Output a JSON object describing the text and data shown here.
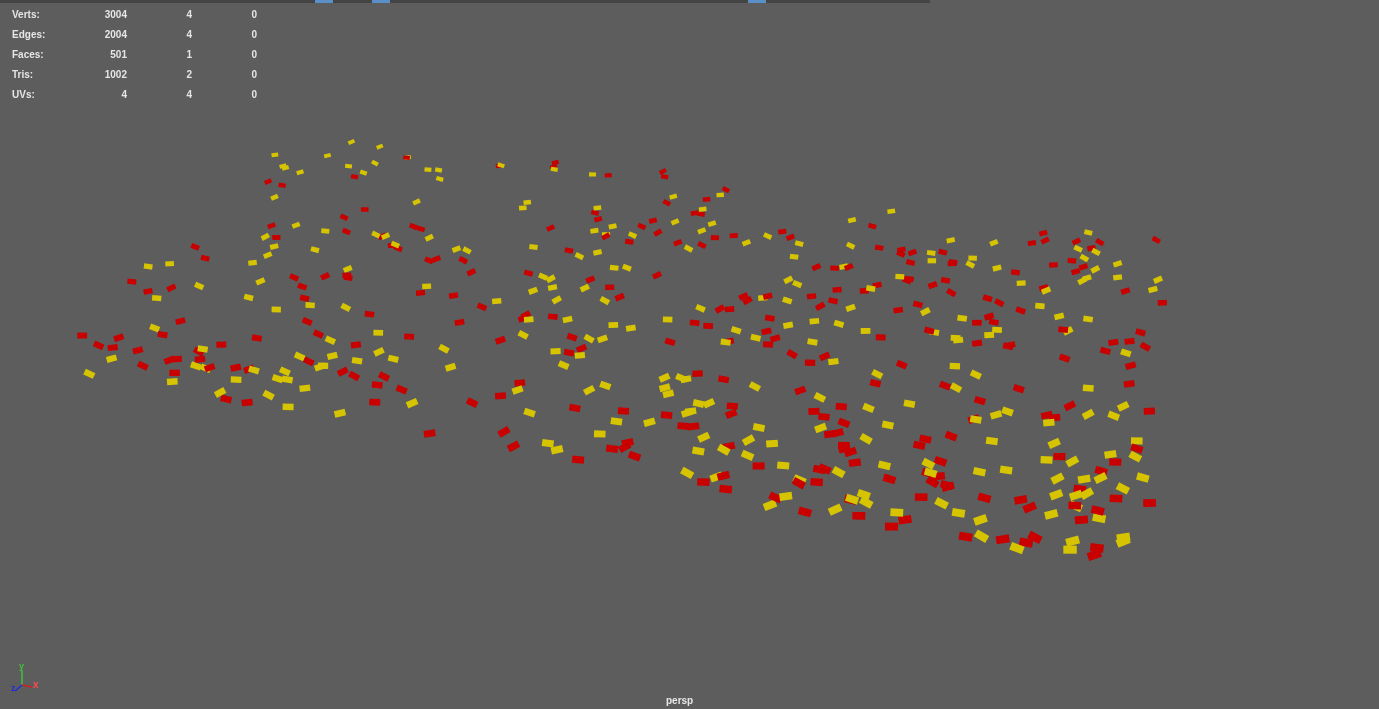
{
  "heads_up_display": {
    "rows": [
      {
        "label": "Verts:",
        "values": [
          "3004",
          "4",
          "0"
        ]
      },
      {
        "label": "Edges:",
        "values": [
          "2004",
          "4",
          "0"
        ]
      },
      {
        "label": "Faces:",
        "values": [
          "501",
          "1",
          "0"
        ]
      },
      {
        "label": "Tris:",
        "values": [
          "1002",
          "2",
          "0"
        ]
      },
      {
        "label": "UVs:",
        "values": [
          "4",
          "4",
          "0"
        ]
      }
    ]
  },
  "axis_gizmo": {
    "x": "x",
    "y": "y",
    "z": "z"
  },
  "camera_label": "persp"
}
